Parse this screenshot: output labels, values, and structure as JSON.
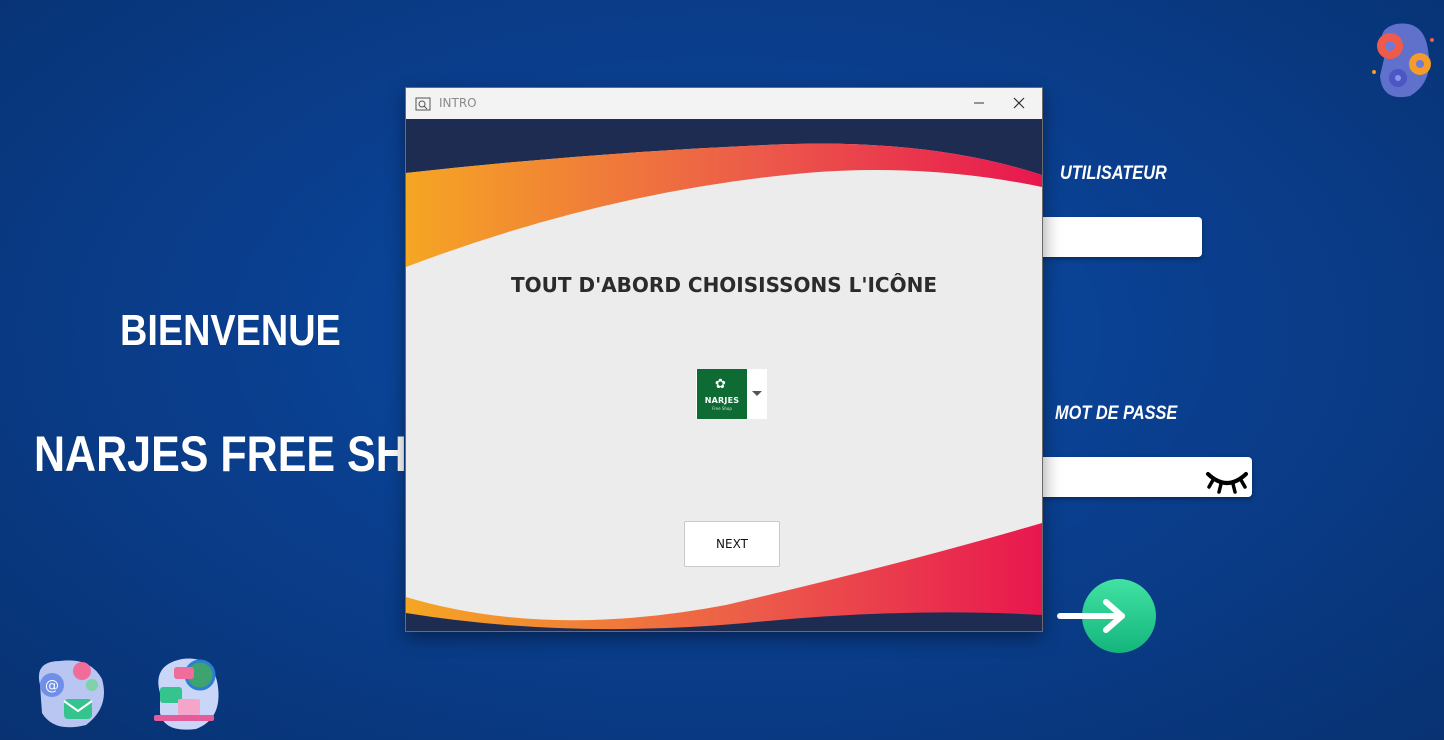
{
  "background": {
    "welcome_text": "BIENVENUE",
    "shop_name": "NARJES FREE SHOP",
    "username_label": "UTILISATEUR",
    "password_label": "MOT DE PASSE",
    "username_value": "",
    "password_value": "",
    "icons": [
      "gears-icon",
      "contact-icon",
      "world-icon",
      "eye-closed-icon",
      "arrow-right-icon"
    ],
    "accent_color": "#1fc48a"
  },
  "dialog": {
    "title": "INTRO",
    "heading": "TOUT D'ABORD CHOISISSONS L'ICÔNE",
    "selected_icon": {
      "brand": "NARJES",
      "subtitle": "Free Shop",
      "color": "#0f6b34"
    },
    "next_label": "NEXT",
    "wave_colors": [
      "#f5a623",
      "#e8174f",
      "#1f2c52"
    ]
  }
}
